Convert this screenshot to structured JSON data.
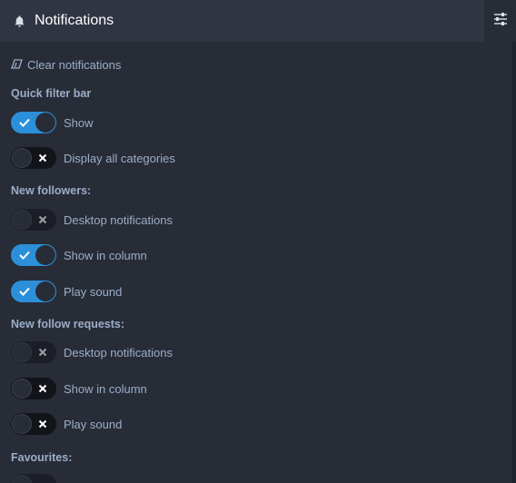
{
  "header": {
    "title": "Notifications",
    "bell_icon": "bell-icon",
    "settings_icon": "sliders-icon"
  },
  "clear": {
    "label": "Clear notifications",
    "icon": "eraser-icon"
  },
  "sections": {
    "quick_filter": {
      "title": "Quick filter bar",
      "items": [
        {
          "label": "Show",
          "on": true
        },
        {
          "label": "Display all categories",
          "on": false
        }
      ]
    },
    "followers": {
      "title": "New followers:",
      "items": [
        {
          "label": "Desktop notifications",
          "on": false,
          "disabled": true
        },
        {
          "label": "Show in column",
          "on": true
        },
        {
          "label": "Play sound",
          "on": true
        }
      ]
    },
    "follow_requests": {
      "title": "New follow requests:",
      "items": [
        {
          "label": "Desktop notifications",
          "on": false,
          "disabled": true
        },
        {
          "label": "Show in column",
          "on": false
        },
        {
          "label": "Play sound",
          "on": false
        }
      ]
    },
    "favourites": {
      "title": "Favourites:"
    }
  },
  "colors": {
    "accent": "#2b90d9",
    "background": "#282c37",
    "header": "#313543",
    "text": "#9baec8"
  }
}
